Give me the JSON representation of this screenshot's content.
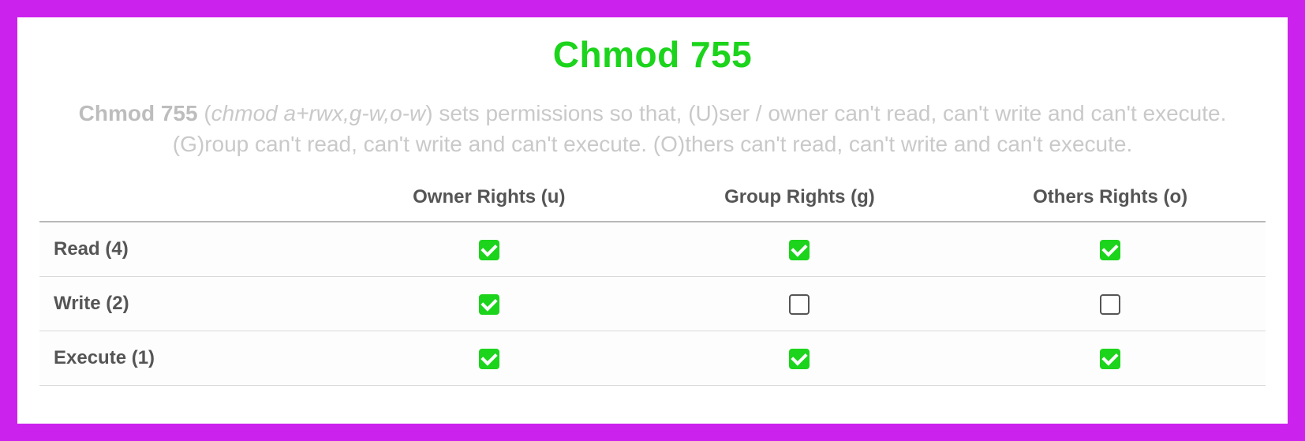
{
  "title": "Chmod 755",
  "desc": {
    "lead": "Chmod 755",
    "paren_open": " (",
    "symbolic": "chmod a+rwx,g-w,o-w",
    "rest": ") sets permissions so that, (U)ser / owner can't read, can't write and can't execute. (G)roup can't read, can't write and can't execute. (O)thers can't read, can't write and can't execute."
  },
  "headers": {
    "blank": "",
    "owner": "Owner Rights (u)",
    "group": "Group Rights (g)",
    "others": "Others Rights (o)"
  },
  "rows": [
    {
      "label": "Read (4)",
      "owner": true,
      "group": true,
      "others": true
    },
    {
      "label": "Write (2)",
      "owner": true,
      "group": false,
      "others": false
    },
    {
      "label": "Execute (1)",
      "owner": true,
      "group": true,
      "others": true
    }
  ]
}
